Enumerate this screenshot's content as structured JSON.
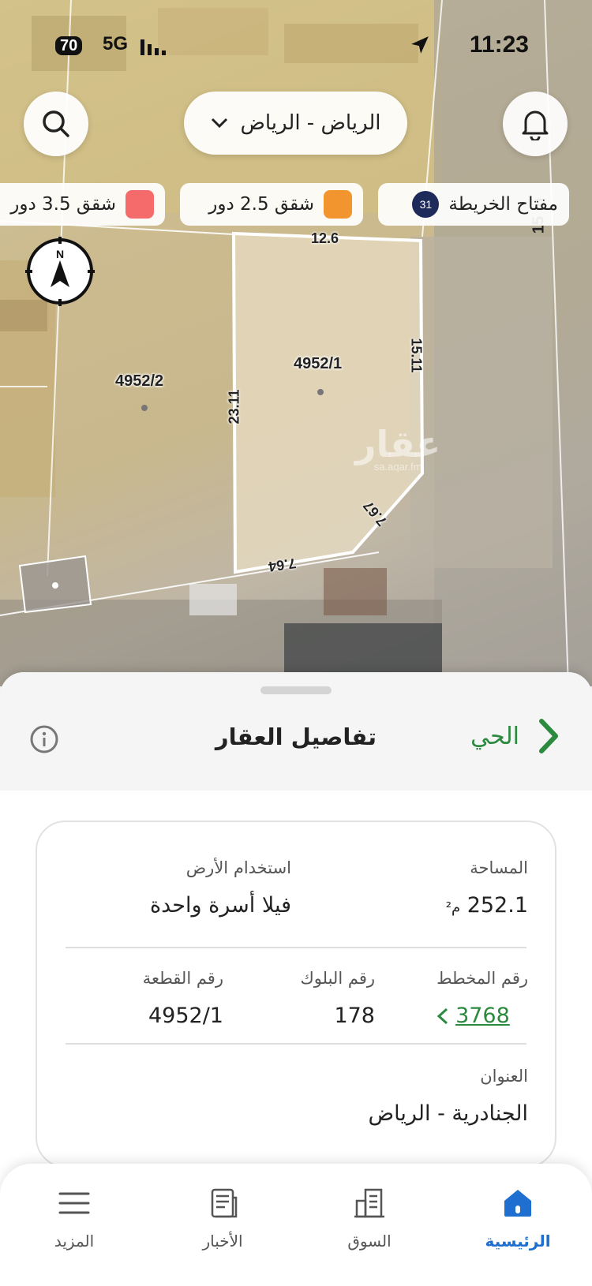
{
  "status_bar": {
    "time": "11:23",
    "battery": "70",
    "network": "5G"
  },
  "header": {
    "city_select": "الرياض - الرياض"
  },
  "legend": {
    "key_label": "مفتاح الخريطة",
    "key_badge": "31",
    "chips": [
      {
        "label": "شقق 2.5 دور",
        "color": "#f2952f"
      },
      {
        "label": "شقق 3.5 دور",
        "color": "#f56b6b"
      }
    ]
  },
  "map": {
    "plots": [
      "4952/1",
      "4952/2"
    ],
    "dimensions": [
      "12.6",
      "15.11",
      "23.11",
      "7.67",
      "7.64"
    ],
    "street": "15 m",
    "watermark": "عقار",
    "watermark_url": "sa.aqar.fm"
  },
  "sheet": {
    "title": "تفاصيل العقار",
    "district_link": "الحي",
    "fields": {
      "area_label": "المساحة",
      "area_value": "252.1",
      "area_unit": "م²",
      "land_use_label": "استخدام الأرض",
      "land_use_value": "فيلا أسرة واحدة",
      "plan_label": "رقم المخطط",
      "plan_value": "3768",
      "block_label": "رقم البلوك",
      "block_value": "178",
      "plot_label": "رقم القطعة",
      "plot_value": "4952/1",
      "address_label": "العنوان",
      "address_value": "الجنادرية - الرياض"
    }
  },
  "tabs": [
    {
      "label": "الرئيسية",
      "active": true
    },
    {
      "label": "السوق"
    },
    {
      "label": "الأخبار"
    },
    {
      "label": "المزيد"
    }
  ],
  "colors": {
    "accent_green": "#2b8a3e",
    "accent_blue": "#1f6fd1"
  }
}
